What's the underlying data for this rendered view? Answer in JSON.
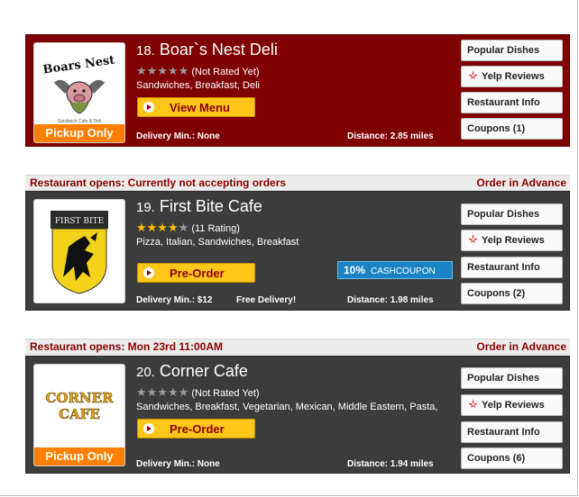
{
  "restaurants": [
    {
      "number": "18.",
      "name": "Boar`s Nest Deli",
      "rating": "(Not Rated Yet)",
      "stars_filled": 0,
      "cuisine": "Sandwiches, Breakfast, Deli",
      "action_label": "View Menu",
      "delivery_min": "Delivery Min.: None",
      "distance": "Distance: 2.85 miles",
      "pickup_label": "Pickup Only",
      "logo_text": "Boars Nest",
      "buttons": [
        "Popular Dishes",
        "Yelp Reviews",
        "Restaurant Info",
        "Coupons (1)"
      ]
    },
    {
      "notice_left": "Restaurant opens: Currently not accepting orders",
      "notice_right": "Order in Advance",
      "number": "19.",
      "name": "First Bite Cafe",
      "rating": "(11 Rating)",
      "stars_filled": 4,
      "cuisine": "Pizza, Italian, Sandwiches, Breakfast",
      "action_label": "Pre-Order",
      "delivery_min": "Delivery Min.: $12",
      "free_delivery": "Free Delivery!",
      "distance": "Distance: 1.98 miles",
      "coupon_pct": "10%",
      "coupon_text": "CASHCOUPON",
      "logo_text": "FIRST BITE",
      "buttons": [
        "Popular Dishes",
        "Yelp Reviews",
        "Restaurant Info",
        "Coupons (2)"
      ]
    },
    {
      "notice_left": "Restaurant opens: Mon 23rd 11:00AM",
      "notice_right": "Order in Advance",
      "number": "20.",
      "name": "Corner Cafe",
      "rating": "(Not Rated Yet)",
      "stars_filled": 0,
      "cuisine": "Sandwiches, Breakfast, Vegetarian, Mexican, Middle Eastern, Pasta,",
      "action_label": "Pre-Order",
      "delivery_min": "Delivery Min.: None",
      "distance": "Distance: 1.94 miles",
      "pickup_label": "Pickup Only",
      "logo_line1": "CORNER",
      "logo_line2": "CAFE",
      "buttons": [
        "Popular Dishes",
        "Yelp Reviews",
        "Restaurant Info",
        "Coupons (6)"
      ]
    }
  ],
  "colors": {
    "accent_red": "#7f0000",
    "dark_card": "#3c3c3c",
    "button_yellow": "#ffc61a",
    "pickup_orange": "#ff7f00",
    "coupon_blue": "#1b82c4",
    "star_gold": "#ffc000"
  }
}
